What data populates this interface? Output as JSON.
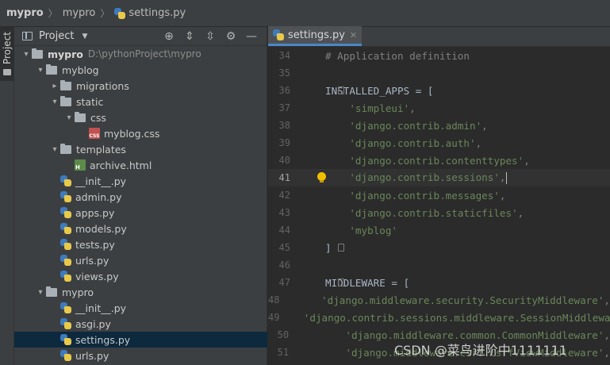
{
  "breadcrumb": [
    "mypro",
    "mypro",
    "settings.py"
  ],
  "side_strip": {
    "label": "Project"
  },
  "panel": {
    "title": "Project"
  },
  "tree": [
    {
      "label": "mypro",
      "path": "D:\\pythonProject\\mypro",
      "type": "folder",
      "level": 0,
      "expanded": true
    },
    {
      "label": "myblog",
      "type": "folder",
      "level": 1,
      "expanded": true
    },
    {
      "label": "migrations",
      "type": "folder",
      "level": 2,
      "expanded": false
    },
    {
      "label": "static",
      "type": "folder",
      "level": 2,
      "expanded": true
    },
    {
      "label": "css",
      "type": "folder",
      "level": 3,
      "expanded": true
    },
    {
      "label": "myblog.css",
      "type": "css",
      "level": 4
    },
    {
      "label": "templates",
      "type": "folder",
      "level": 2,
      "expanded": true
    },
    {
      "label": "archive.html",
      "type": "html",
      "level": 3
    },
    {
      "label": "__init__.py",
      "type": "py",
      "level": 2
    },
    {
      "label": "admin.py",
      "type": "py",
      "level": 2
    },
    {
      "label": "apps.py",
      "type": "py",
      "level": 2
    },
    {
      "label": "models.py",
      "type": "py",
      "level": 2
    },
    {
      "label": "tests.py",
      "type": "py",
      "level": 2
    },
    {
      "label": "urls.py",
      "type": "py",
      "level": 2
    },
    {
      "label": "views.py",
      "type": "py",
      "level": 2
    },
    {
      "label": "mypro",
      "type": "folder",
      "level": 1,
      "expanded": true
    },
    {
      "label": "__init__.py",
      "type": "py",
      "level": 2
    },
    {
      "label": "asgi.py",
      "type": "py",
      "level": 2
    },
    {
      "label": "settings.py",
      "type": "py",
      "level": 2,
      "selected": true
    },
    {
      "label": "urls.py",
      "type": "py",
      "level": 2
    }
  ],
  "editor": {
    "tab_label": "settings.py",
    "current_line": 41,
    "lines": [
      {
        "n": "34",
        "text": "# Application definition",
        "kind": "comment"
      },
      {
        "n": "35",
        "text": "",
        "kind": "plain"
      },
      {
        "n": "36",
        "text": "INSTALLED_APPS = [",
        "kind": "plain",
        "fold": true
      },
      {
        "n": "37",
        "text": "'simpleui'",
        "kind": "string",
        "suffix": ","
      },
      {
        "n": "38",
        "text": "'django.contrib.admin'",
        "kind": "string",
        "suffix": ","
      },
      {
        "n": "39",
        "text": "'django.contrib.auth'",
        "kind": "string",
        "suffix": ","
      },
      {
        "n": "40",
        "text": "'django.contrib.contenttypes'",
        "kind": "string",
        "suffix": ","
      },
      {
        "n": "41",
        "text": "'django.contrib.sessions'",
        "kind": "string",
        "suffix": ",",
        "current": true
      },
      {
        "n": "42",
        "text": "'django.contrib.messages'",
        "kind": "string",
        "suffix": ","
      },
      {
        "n": "43",
        "text": "'django.contrib.staticfiles'",
        "kind": "string",
        "suffix": ","
      },
      {
        "n": "44",
        "text": "'myblog'",
        "kind": "string",
        "suffix": ""
      },
      {
        "n": "45",
        "text": "]",
        "kind": "plain",
        "fold": true
      },
      {
        "n": "46",
        "text": "",
        "kind": "plain"
      },
      {
        "n": "47",
        "text": "MIDDLEWARE = [",
        "kind": "plain",
        "fold": true
      },
      {
        "n": "48",
        "text": "'django.middleware.security.SecurityMiddleware'",
        "kind": "string",
        "suffix": ","
      },
      {
        "n": "49",
        "text": "'django.contrib.sessions.middleware.SessionMiddleware'",
        "kind": "string",
        "suffix": ","
      },
      {
        "n": "50",
        "text": "'django.middleware.common.CommonMiddleware'",
        "kind": "string",
        "suffix": ","
      },
      {
        "n": "51",
        "text": "'django.middleware.csrf.CsrfViewMiddleware'",
        "kind": "string",
        "suffix": ","
      }
    ]
  },
  "watermark": "CSDN @菜鸟进阶中1111111"
}
